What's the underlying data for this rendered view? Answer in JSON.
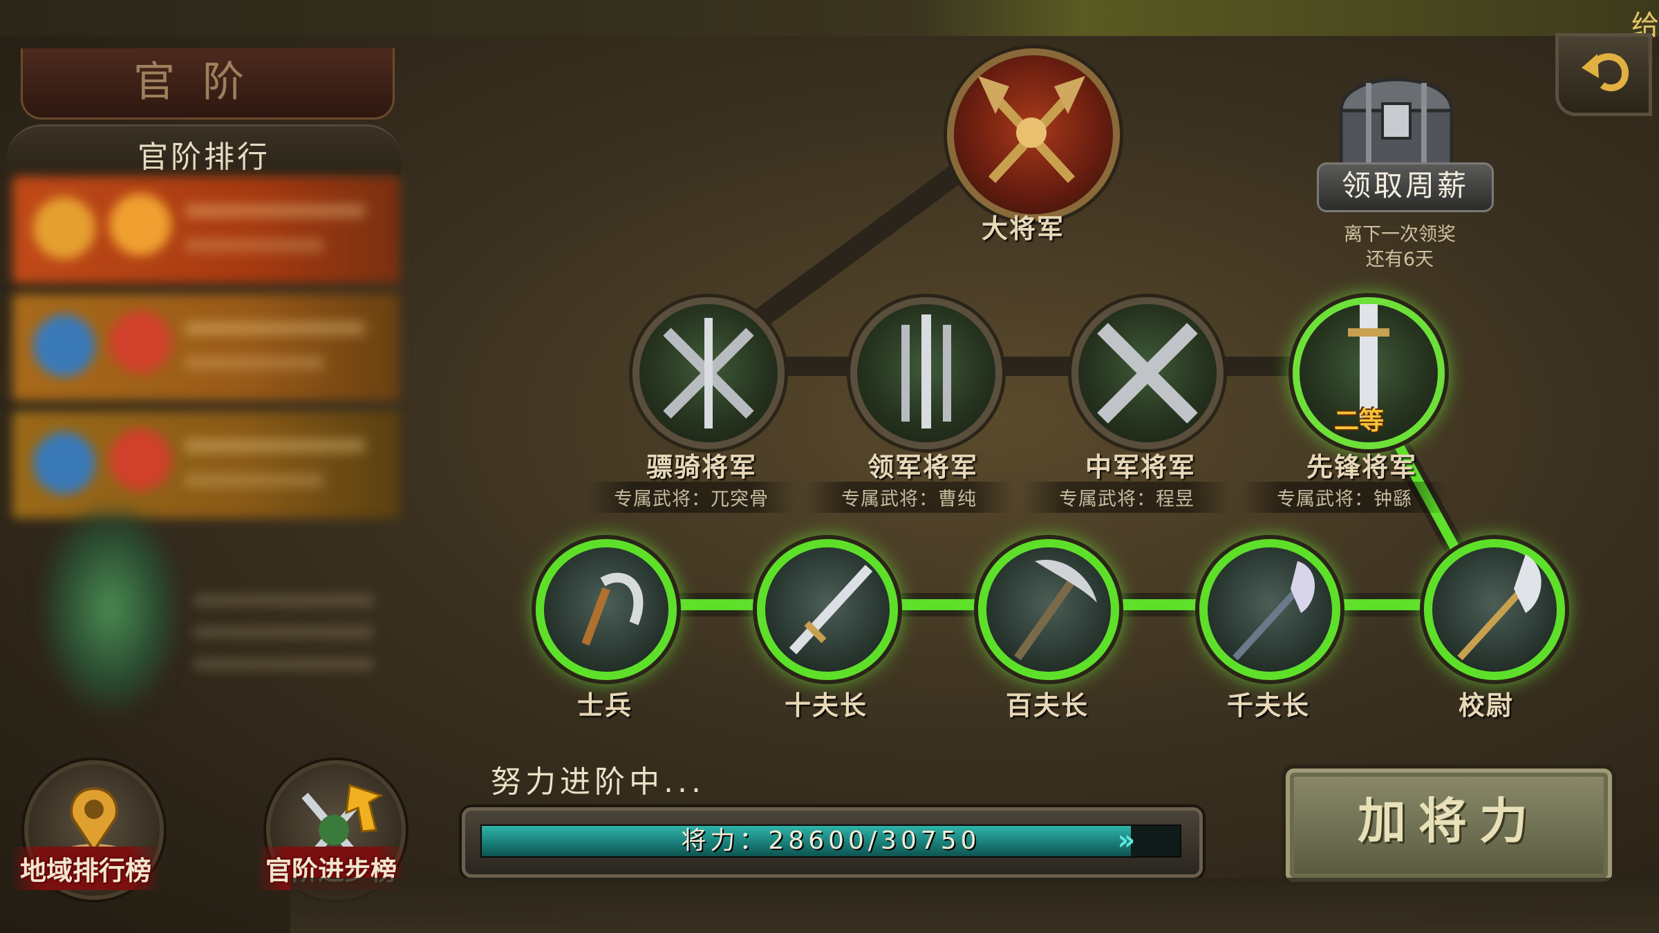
{
  "top_right_text": "给",
  "panel": {
    "title": "官阶",
    "ranking_header": "官阶排行"
  },
  "buttons": {
    "region_ranking": "地域排行榜",
    "rank_progress": "官阶进步榜",
    "add_power": "加将力",
    "weekly_salary": "领取周薪"
  },
  "weekly_salary": {
    "line1": "离下一次领奖",
    "line2": "还有6天"
  },
  "top_rank": {
    "name": "大将军"
  },
  "mid_ranks": [
    {
      "name": "骠骑将军",
      "officer": "专属武将：兀突骨"
    },
    {
      "name": "领军将军",
      "officer": "专属武将：曹纯"
    },
    {
      "name": "中军将军",
      "officer": "专属武将：程昱"
    },
    {
      "name": "先锋将军",
      "officer": "专属武将：钟繇",
      "grade": "二等"
    }
  ],
  "low_ranks": [
    {
      "name": "士兵"
    },
    {
      "name": "十夫长"
    },
    {
      "name": "百夫长"
    },
    {
      "name": "千夫长"
    },
    {
      "name": "校尉"
    }
  ],
  "progress": {
    "caption": "努力进阶中...",
    "label": "将力：28600/30750",
    "current": 28600,
    "max": 30750
  },
  "colors": {
    "active_path": "#5ee02a",
    "progress_fill": "#2fb3a8",
    "gold_text": "#f5c23a"
  }
}
